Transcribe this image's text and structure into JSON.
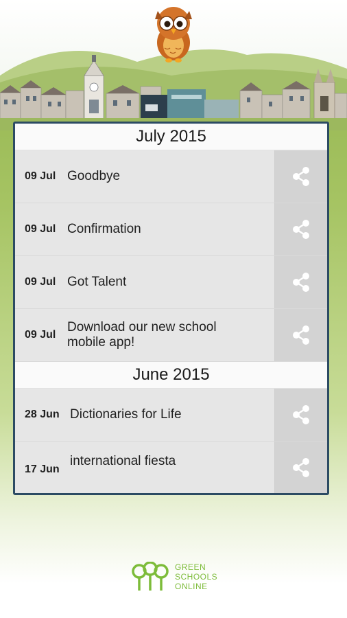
{
  "sections": [
    {
      "month": "July 2015",
      "items": [
        {
          "date": "09 Jul",
          "title": "Goodbye"
        },
        {
          "date": "09 Jul",
          "title": "Confirmation"
        },
        {
          "date": "09 Jul",
          "title": "Got Talent"
        },
        {
          "date": "09 Jul",
          "title": "Download our new school mobile app!"
        }
      ]
    },
    {
      "month": "June 2015",
      "items": [
        {
          "date": "28 Jun",
          "title": "Dictionaries for Life"
        },
        {
          "date": "17 Jun",
          "title": "international fiesta"
        }
      ]
    }
  ],
  "footer": {
    "logo_line1": "GREEN",
    "logo_line2": "SCHOOLS",
    "logo_line3": "ONLINE"
  },
  "colors": {
    "panel_border": "#2c4b63",
    "logo_green": "#7dbc3a"
  },
  "icons": {
    "share": "share-icon",
    "owl": "owl-mascot-icon"
  }
}
